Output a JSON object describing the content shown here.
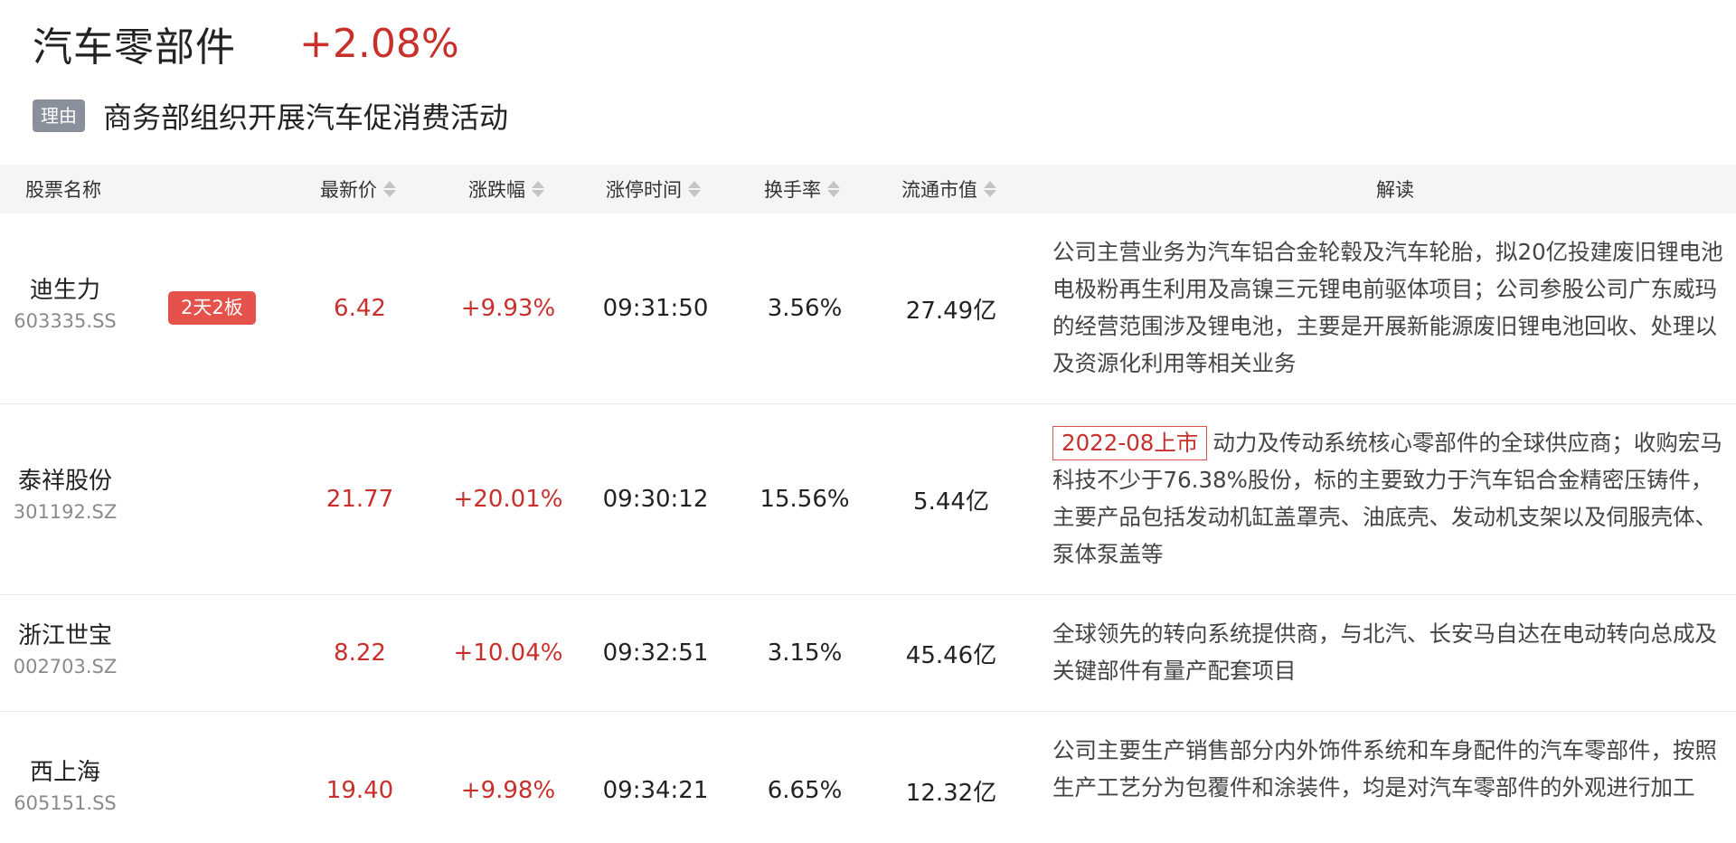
{
  "sector": {
    "name": "汽车零部件",
    "change": "+2.08%"
  },
  "reason": {
    "badge": "理由",
    "text": "商务部组织开展汽车促消费活动"
  },
  "table": {
    "headers": {
      "name": "股票名称",
      "price": "最新价",
      "change": "涨跌幅",
      "limit_time": "涨停时间",
      "turnover": "换手率",
      "float_cap": "流通市值",
      "desc": "解读"
    },
    "rows": [
      {
        "name": "迪生力",
        "code": "603335.SS",
        "tag": "2天2板",
        "price": "6.42",
        "change": "+9.93%",
        "limit_time": "09:31:50",
        "turnover": "3.56%",
        "float_cap": "27.49亿",
        "listing": "",
        "desc": "公司主营业务为汽车铝合金轮毂及汽车轮胎，拟20亿投建废旧锂电池电极粉再生利用及高镍三元锂电前驱体项目；公司参股公司广东威玛的经营范围涉及锂电池，主要是开展新能源废旧锂电池回收、处理以及资源化利用等相关业务"
      },
      {
        "name": "泰祥股份",
        "code": "301192.SZ",
        "tag": "",
        "price": "21.77",
        "change": "+20.01%",
        "limit_time": "09:30:12",
        "turnover": "15.56%",
        "float_cap": "5.44亿",
        "listing": "2022-08上市",
        "desc": "动力及传动系统核心零部件的全球供应商；收购宏马科技不少于76.38%股份，标的主要致力于汽车铝合金精密压铸件，主要产品包括发动机缸盖罩壳、油底壳、发动机支架以及伺服壳体、泵体泵盖等"
      },
      {
        "name": "浙江世宝",
        "code": "002703.SZ",
        "tag": "",
        "price": "8.22",
        "change": "+10.04%",
        "limit_time": "09:32:51",
        "turnover": "3.15%",
        "float_cap": "45.46亿",
        "listing": "",
        "desc": "全球领先的转向系统提供商，与北汽、长安马自达在电动转向总成及关键部件有量产配套项目"
      },
      {
        "name": "西上海",
        "code": "605151.SS",
        "tag": "",
        "price": "19.40",
        "change": "+9.98%",
        "limit_time": "09:34:21",
        "turnover": "6.65%",
        "float_cap": "12.32亿",
        "listing": "",
        "desc": "公司主要生产销售部分内外饰件系统和车身配件的汽车零部件，按照生产工艺分为包覆件和涂装件，均是对汽车零部件的外观进行加工"
      }
    ]
  },
  "colors": {
    "up": "#c8302c",
    "tag": "#e5524b",
    "header_bg": "#f5f5f5"
  }
}
